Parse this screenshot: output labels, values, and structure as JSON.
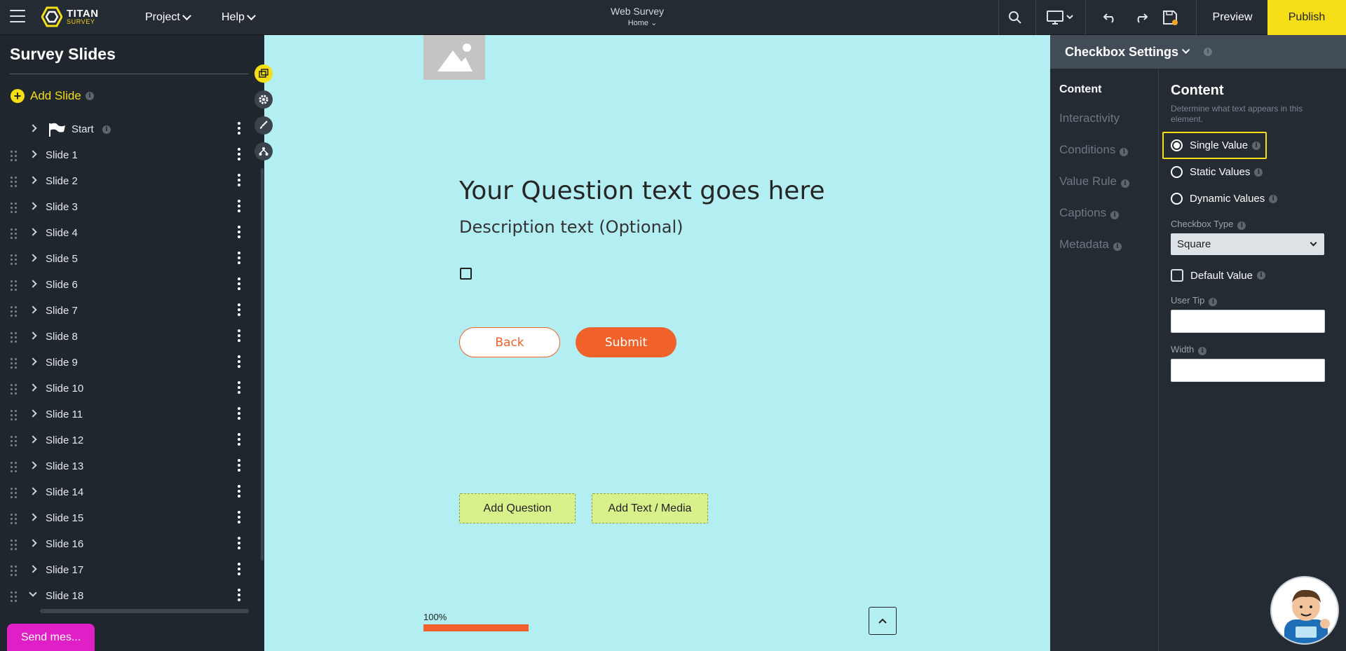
{
  "header": {
    "logo_line1": "TITAN",
    "logo_line2": "SURVEY",
    "nav": [
      {
        "label": "Project"
      },
      {
        "label": "Help"
      }
    ],
    "doc_title": "Web Survey",
    "doc_subtitle": "Home",
    "preview_label": "Preview",
    "publish_label": "Publish"
  },
  "sidebar": {
    "title": "Survey Slides",
    "add_slide_label": "Add Slide",
    "start_label": "Start",
    "slides": [
      {
        "label": "Slide 1"
      },
      {
        "label": "Slide 2"
      },
      {
        "label": "Slide 3"
      },
      {
        "label": "Slide 4"
      },
      {
        "label": "Slide 5"
      },
      {
        "label": "Slide 6"
      },
      {
        "label": "Slide 7"
      },
      {
        "label": "Slide 8"
      },
      {
        "label": "Slide 9"
      },
      {
        "label": "Slide 10"
      },
      {
        "label": "Slide 11"
      },
      {
        "label": "Slide 12"
      },
      {
        "label": "Slide 13"
      },
      {
        "label": "Slide 14"
      },
      {
        "label": "Slide 15"
      },
      {
        "label": "Slide 16"
      },
      {
        "label": "Slide 17"
      },
      {
        "label": "Slide 18",
        "expanded": true
      }
    ],
    "chat_label": "Send mes..."
  },
  "tools": [
    "layers-icon",
    "settings-icon",
    "brush-icon",
    "hierarchy-icon"
  ],
  "canvas": {
    "question_title": "Your Question text goes here",
    "description": "Description text (Optional)",
    "back_label": "Back",
    "submit_label": "Submit",
    "add_question_label": "Add Question",
    "add_media_label": "Add Text / Media",
    "progress_label": "100%",
    "progress_value": 1.0
  },
  "panel": {
    "title": "Checkbox Settings",
    "nav": [
      {
        "label": "Content",
        "active": true
      },
      {
        "label": "Interactivity"
      },
      {
        "label": "Conditions"
      },
      {
        "label": "Value Rule"
      },
      {
        "label": "Captions"
      },
      {
        "label": "Metadata"
      }
    ],
    "content_heading": "Content",
    "content_sub": "Determine what text appears in this element.",
    "options": [
      {
        "label": "Single Value",
        "selected": true
      },
      {
        "label": "Static Values",
        "selected": false
      },
      {
        "label": "Dynamic Values",
        "selected": false
      }
    ],
    "checkbox_type_label": "Checkbox Type",
    "checkbox_type_value": "Square",
    "default_value_label": "Default Value",
    "default_value_checked": false,
    "user_tip_label": "User Tip",
    "user_tip_value": "",
    "width_label": "Width",
    "width_value": ""
  },
  "colors": {
    "accent_yellow": "#f5de16",
    "accent_orange": "#f0622a",
    "canvas_bg": "#b3eff2",
    "chat_pink": "#e020c6"
  }
}
